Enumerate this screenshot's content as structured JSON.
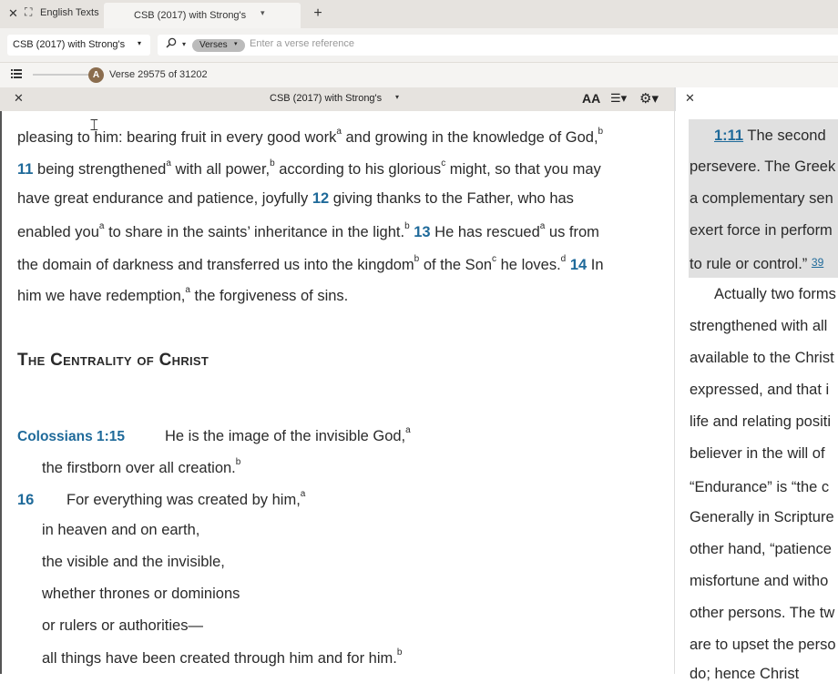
{
  "tabbar": {
    "close_icon": "close-icon",
    "expand_icon": "expand-icon",
    "english_tab": "English Texts",
    "active_tab": "CSB (2017) with Strong's",
    "add_label": "+"
  },
  "refbar": {
    "resource": "CSB (2017) with Strong's",
    "search_mode": "Verses",
    "search_placeholder": "Enter a verse reference"
  },
  "progress": {
    "badge": "A",
    "verse_text": "Verse 29575 of 31202",
    "verse_current": 29575,
    "verse_total": 31202
  },
  "left_panel": {
    "title": "CSB (2017) with Strong's",
    "font_label": "AA"
  },
  "passage": {
    "line1": [
      "pleasing to him: bearing fruit in every good work",
      "a",
      " and growing in the knowledge of God,",
      "b"
    ],
    "v11_num": "11",
    "line2": [
      " being strengthened",
      "a",
      " with all power,",
      "b",
      " according to his glorious",
      "c",
      " might, so that you may"
    ],
    "line3a": "have great endurance and patience, joyfully ",
    "v12_num": "12",
    "line3b": " giving thanks to the Father, who has",
    "line4a": [
      "enabled you",
      "a",
      " to share in the saints’ inheritance in the light.",
      "b",
      " "
    ],
    "v13_num": "13",
    "line4b": [
      " He has rescued",
      "a",
      " us from"
    ],
    "line5a": [
      "the domain of darkness and transferred us into the kingdom",
      "b",
      " of the Son",
      "c",
      " he loves.",
      "d",
      " "
    ],
    "v14_num": "14",
    "line5b": " In",
    "line6": [
      "him we have redemption,",
      "a",
      " the forgiveness of sins."
    ],
    "heading": "The Centrality of Christ",
    "ref": "Colossians 1:15",
    "p1": [
      "He is the image of the invisible God,",
      "a"
    ],
    "p2": [
      "the firstborn over all creation.",
      "b"
    ],
    "v16_num": "16",
    "p3": [
      "For everything was created by him,",
      "a"
    ],
    "p4": "in heaven and on earth,",
    "p5": "the visible and the invisible,",
    "p6": "whether thrones or dominions",
    "p7": "or rulers or authorities—",
    "p8": [
      "all things have been created through him and for him.",
      "b"
    ]
  },
  "commentary": {
    "ref_link": "1:11",
    "c1": " The second",
    "c2": "persevere. The Greek",
    "c3": "a complementary sen",
    "c4": "exert force in perform",
    "c5": "to rule or control.”",
    "c5_note": "39",
    "c6": "Actually two forms",
    "c7": "strengthened with all",
    "c8": "available to the Christ",
    "c9": "expressed, and that i",
    "c10": "life and relating positi",
    "c11": "believer in the will of",
    "c12": "“Endurance” is “the c",
    "c13": "Generally in Scripture",
    "c14": "other hand, “patience",
    "c15": "misfortune and witho",
    "c16": "other persons. The tw",
    "c17": "are to upset the perso",
    "c18": "do; hence Christ"
  }
}
